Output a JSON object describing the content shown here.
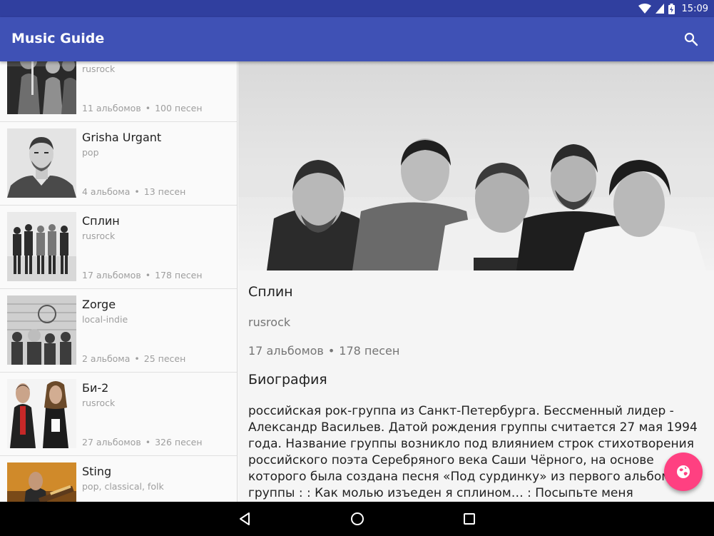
{
  "status": {
    "time": "15:09"
  },
  "app": {
    "title": "Music Guide"
  },
  "list": [
    {
      "name": "",
      "genre": "rusrock",
      "albums": "11 альбомов",
      "songs": "100 песен"
    },
    {
      "name": "Grisha Urgant",
      "genre": "pop",
      "albums": "4 альбома",
      "songs": "13 песен"
    },
    {
      "name": "Сплин",
      "genre": "rusrock",
      "albums": "17 альбомов",
      "songs": "178 песен"
    },
    {
      "name": "Zorge",
      "genre": "local-indie",
      "albums": "2 альбома",
      "songs": "25 песен"
    },
    {
      "name": "Би-2",
      "genre": "rusrock",
      "albums": "27 альбомов",
      "songs": "326 песен"
    },
    {
      "name": "Sting",
      "genre": "pop, classical, folk",
      "albums": "",
      "songs": ""
    }
  ],
  "detail": {
    "name": "Сплин",
    "genre": "rusrock",
    "albums": "17 альбомов",
    "songs": "178 песен",
    "bio_title": "Биография",
    "bio": "российская рок-группа из Санкт-Петербурга. Бессменный лидер - Александр Васильев. Датой рождения группы считается 27 мая 1994 года. Название группы возникло под влиянием строк стихотворения российского поэта Серебряного века Саши Чёрного, на основе которого была создана песня «Под сурдинку» из первого альбома группы : : Как молью изъеден я сплином… : Посыпьте меня"
  },
  "colors": {
    "primary": "#3f51b5",
    "primary_dark": "#303f9f",
    "accent": "#ff4081"
  },
  "icons": [
    "wifi-icon",
    "signal-icon",
    "battery-icon",
    "search-icon",
    "globe-icon",
    "back-icon",
    "home-icon",
    "recents-icon"
  ]
}
